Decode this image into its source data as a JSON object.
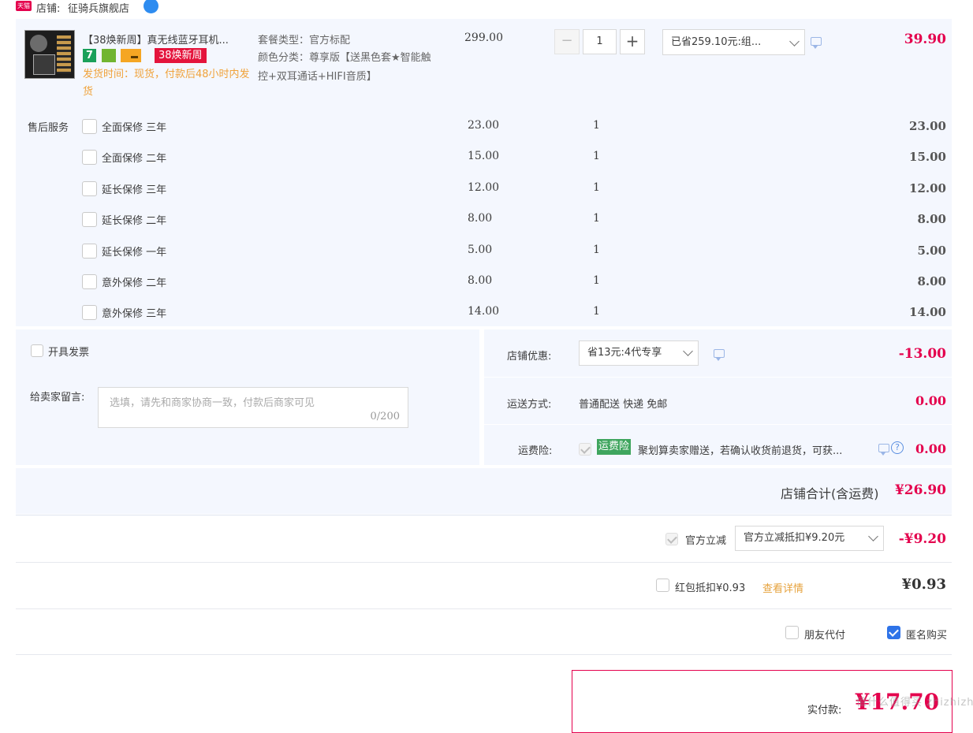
{
  "shop": {
    "platform_badge": "天猫",
    "label": "店铺:",
    "name": "征骑兵旗舰店"
  },
  "product": {
    "title": "【38焕新周】真无线蓝牙耳机...",
    "badges": {
      "seven": "7",
      "promo": "38焕新周"
    },
    "shipping_note": "发货时间：现货，付款后48小时内发货",
    "spec_package": "套餐类型：官方标配",
    "spec_color": "颜色分类：尊享版【送黑色套★智能触控+双耳通话+HIFI音质】",
    "price": "299.00",
    "quantity": "1",
    "discount_select": "已省259.10元:组...",
    "total": "39.90"
  },
  "after_sales": {
    "label": "售后服务",
    "items": [
      {
        "name": "全面保修 三年",
        "price": "23.00",
        "qty": "1",
        "total": "23.00"
      },
      {
        "name": "全面保修 二年",
        "price": "15.00",
        "qty": "1",
        "total": "15.00"
      },
      {
        "name": "延长保修 三年",
        "price": "12.00",
        "qty": "1",
        "total": "12.00"
      },
      {
        "name": "延长保修 二年",
        "price": "8.00",
        "qty": "1",
        "total": "8.00"
      },
      {
        "name": "延长保修 一年",
        "price": "5.00",
        "qty": "1",
        "total": "5.00"
      },
      {
        "name": "意外保修 二年",
        "price": "8.00",
        "qty": "1",
        "total": "8.00"
      },
      {
        "name": "意外保修 三年",
        "price": "14.00",
        "qty": "1",
        "total": "14.00"
      }
    ]
  },
  "invoice": {
    "label": "开具发票"
  },
  "message": {
    "label": "给卖家留言:",
    "placeholder": "选填，请先和商家协商一致，付款后商家可见",
    "counter": "0/200"
  },
  "shop_discount": {
    "label": "店铺优惠:",
    "select": "省13元:4代专享",
    "amount": "-13.00"
  },
  "shipping": {
    "label": "运送方式:",
    "method": "普通配送 快递 免邮",
    "amount": "0.00"
  },
  "insurance": {
    "label": "运费险:",
    "tag": "运费险",
    "desc": "聚划算卖家赠送，若确认收货前退货，可获...",
    "amount": "0.00"
  },
  "shop_total": {
    "label": "店铺合计(含运费)",
    "amount": "¥26.90"
  },
  "official": {
    "label": "官方立减",
    "select": "官方立减抵扣¥9.20元",
    "amount": "-¥9.20"
  },
  "redpacket": {
    "label": "红包抵扣¥0.93",
    "link": "查看详情",
    "amount": "¥0.93"
  },
  "options": {
    "friend_pay": "朋友代付",
    "anonymous": "匿名购买"
  },
  "payment": {
    "label": "实付款:",
    "amount": "¥17.70"
  },
  "watermark": "值什么值得买 zhizhizhi.com",
  "colors": {
    "accent_red": "#e4004d",
    "panel_bg": "#f4f7fe",
    "checkbox_blue": "#2e73e8",
    "insurance_green": "#3fa55e"
  }
}
